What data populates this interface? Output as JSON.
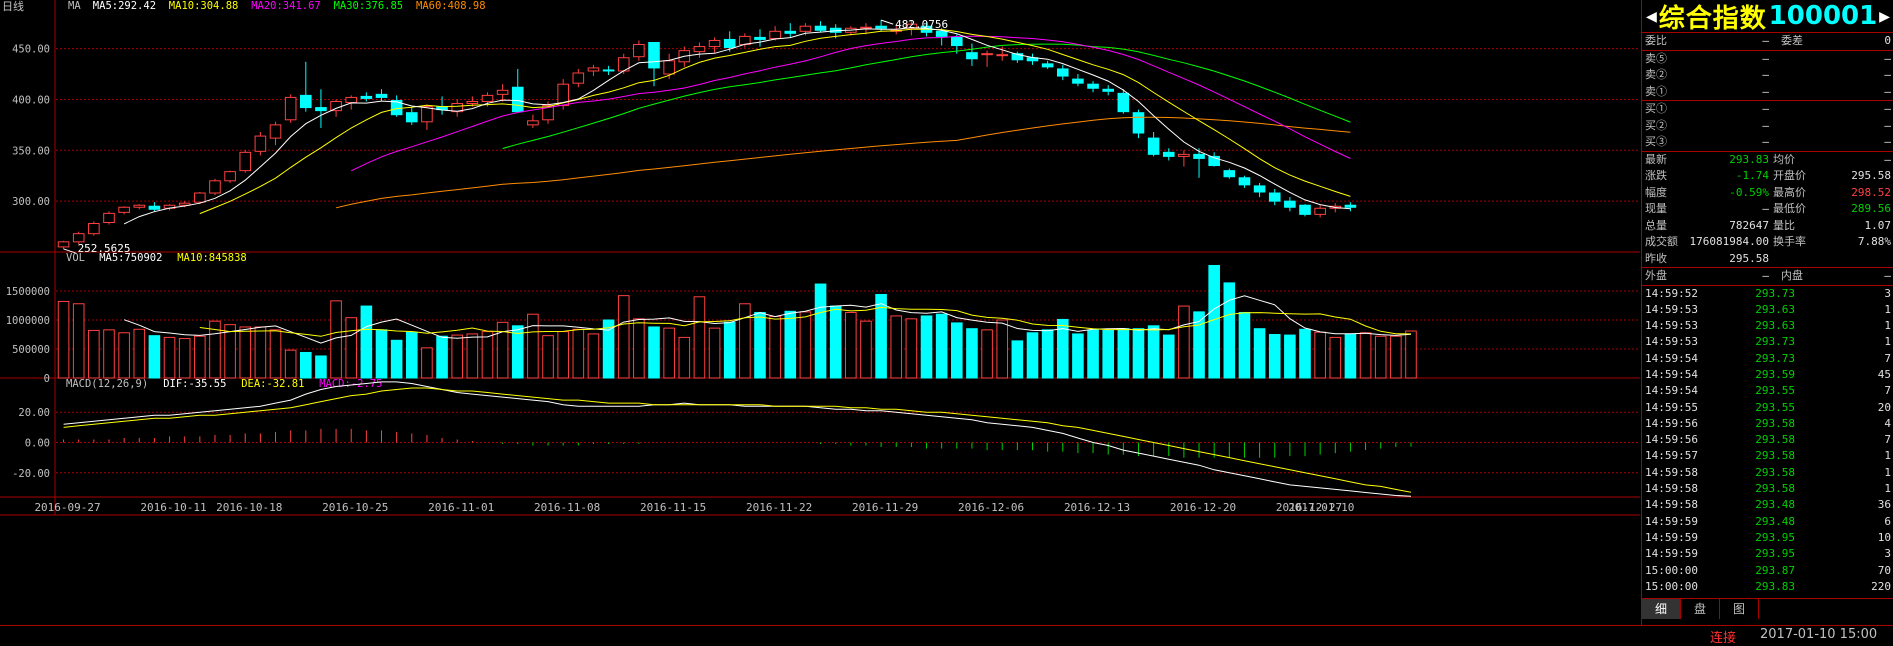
{
  "period_label": "日线",
  "ma_headers": [
    {
      "text": "MA",
      "color": "#c0c0c0"
    },
    {
      "text": "MA5:292.42",
      "color": "#ffffff"
    },
    {
      "text": "MA10:304.88",
      "color": "#ffff00"
    },
    {
      "text": "MA20:341.67",
      "color": "#ff00ff"
    },
    {
      "text": "MA30:376.85",
      "color": "#00ff00"
    },
    {
      "text": "MA60:408.98",
      "color": "#ff8c00"
    }
  ],
  "vol_headers": [
    {
      "text": "VOL",
      "color": "#c0c0c0"
    },
    {
      "text": "MA5:750902",
      "color": "#ffffff"
    },
    {
      "text": "MA10:845838",
      "color": "#ffff00"
    }
  ],
  "macd_headers": [
    {
      "text": "MACD(12,26,9)",
      "color": "#c0c0c0"
    },
    {
      "text": "DIF:-35.55",
      "color": "#ffffff"
    },
    {
      "text": "DEA:-32.81",
      "color": "#ffff00"
    },
    {
      "text": "MACD:-2.75",
      "color": "#ff00ff"
    }
  ],
  "chart_data": [
    {
      "type": "candlestick",
      "ylim": [
        250,
        485
      ],
      "y_ticks": [
        "450.00",
        "400.00",
        "350.00",
        "300.00"
      ],
      "max_label": "482.0756",
      "min_label": "252.5625",
      "colors": {
        "up": "#ff4040",
        "down": "#00ffff",
        "ma5": "#ffffff",
        "ma10": "#ffff00",
        "ma20": "#ff00ff",
        "ma30": "#00ff00",
        "ma60": "#ff8c00"
      },
      "candles": [
        [
          255,
          261,
          253,
          260
        ],
        [
          260,
          270,
          258,
          268
        ],
        [
          268,
          280,
          266,
          278
        ],
        [
          279,
          290,
          277,
          288
        ],
        [
          289,
          295,
          287,
          294
        ],
        [
          294,
          297,
          292,
          296
        ],
        [
          295,
          299,
          290,
          292
        ],
        [
          293,
          297,
          291,
          296
        ],
        [
          296,
          300,
          294,
          298
        ],
        [
          299,
          309,
          297,
          308
        ],
        [
          308,
          322,
          306,
          320
        ],
        [
          320,
          330,
          318,
          329
        ],
        [
          330,
          350,
          328,
          348
        ],
        [
          349,
          368,
          345,
          364
        ],
        [
          362,
          378,
          355,
          375
        ],
        [
          380,
          405,
          377,
          402
        ],
        [
          404,
          437,
          388,
          392
        ],
        [
          392,
          410,
          372,
          389
        ],
        [
          389,
          400,
          383,
          398
        ],
        [
          397,
          404,
          390,
          402
        ],
        [
          403,
          407,
          398,
          401
        ],
        [
          405,
          410,
          398,
          402
        ],
        [
          399,
          404,
          383,
          385
        ],
        [
          387,
          392,
          375,
          378
        ],
        [
          378,
          395,
          370,
          393
        ],
        [
          393,
          403,
          385,
          390
        ],
        [
          388,
          400,
          383,
          396
        ],
        [
          396,
          403,
          393,
          398
        ],
        [
          398,
          407,
          393,
          404
        ],
        [
          405,
          415,
          398,
          409
        ],
        [
          412,
          430,
          390,
          388
        ],
        [
          375,
          385,
          372,
          379
        ],
        [
          380,
          398,
          376,
          394
        ],
        [
          394,
          420,
          390,
          415
        ],
        [
          416,
          430,
          412,
          426
        ],
        [
          428,
          434,
          423,
          431
        ],
        [
          429,
          433,
          424,
          428
        ],
        [
          428,
          445,
          425,
          441
        ],
        [
          442,
          458,
          438,
          454
        ],
        [
          456,
          448,
          413,
          431
        ],
        [
          425,
          445,
          420,
          438
        ],
        [
          437,
          452,
          432,
          448
        ],
        [
          447,
          456,
          441,
          452
        ],
        [
          452,
          461,
          446,
          458
        ],
        [
          459,
          467,
          447,
          451
        ],
        [
          454,
          465,
          451,
          462
        ],
        [
          461,
          469,
          452,
          459
        ],
        [
          460,
          472,
          458,
          467
        ],
        [
          467,
          475,
          461,
          465
        ],
        [
          467,
          475,
          463,
          472
        ],
        [
          472,
          477,
          466,
          468
        ],
        [
          470,
          474,
          460,
          466
        ],
        [
          466,
          472,
          463,
          470
        ],
        [
          470,
          475,
          464,
          471
        ],
        [
          472,
          478,
          467,
          470
        ],
        [
          468,
          473,
          464,
          468
        ],
        [
          470,
          477,
          463,
          474
        ],
        [
          472,
          476,
          462,
          466
        ],
        [
          467,
          470,
          453,
          462
        ],
        [
          461,
          464,
          445,
          453
        ],
        [
          446,
          455,
          433,
          440
        ],
        [
          444,
          448,
          432,
          445
        ],
        [
          444,
          452,
          438,
          444
        ],
        [
          445,
          447,
          436,
          439
        ],
        [
          441,
          445,
          434,
          438
        ],
        [
          435,
          438,
          430,
          432
        ],
        [
          430,
          434,
          419,
          423
        ],
        [
          420,
          425,
          413,
          416
        ],
        [
          415,
          418,
          407,
          411
        ],
        [
          410,
          414,
          404,
          408
        ],
        [
          406,
          410,
          386,
          388
        ],
        [
          387,
          390,
          362,
          367
        ],
        [
          362,
          368,
          344,
          346
        ],
        [
          348,
          352,
          340,
          344
        ],
        [
          344,
          350,
          334,
          346
        ],
        [
          346,
          352,
          323,
          342
        ],
        [
          344,
          348,
          334,
          335
        ],
        [
          330,
          332,
          322,
          324
        ],
        [
          323,
          325,
          313,
          316
        ],
        [
          315,
          318,
          304,
          309
        ],
        [
          308,
          312,
          296,
          300
        ],
        [
          300,
          304,
          290,
          294
        ],
        [
          296,
          297,
          285,
          287
        ],
        [
          287,
          296,
          284,
          293
        ],
        [
          293,
          298,
          289,
          295
        ],
        [
          296,
          299,
          290,
          294
        ]
      ]
    },
    {
      "type": "bar",
      "y_ticks": [
        "1500000",
        "1000000",
        "500000",
        "0"
      ],
      "ylim": [
        0,
        2000000
      ],
      "values": [
        1320000,
        1280000,
        820000,
        830000,
        780000,
        840000,
        730000,
        700000,
        680000,
        720000,
        980000,
        920000,
        880000,
        880000,
        830000,
        480000,
        440000,
        380000,
        1330000,
        1040000,
        1240000,
        830000,
        650000,
        790000,
        520000,
        720000,
        740000,
        760000,
        800000,
        960000,
        900000,
        1100000,
        730000,
        800000,
        840000,
        760000,
        1000000,
        1420000,
        1020000,
        880000,
        860000,
        700000,
        1400000,
        860000,
        960000,
        1280000,
        1130000,
        1060000,
        1150000,
        1140000,
        1620000,
        1240000,
        1130000,
        980000,
        1440000,
        1070000,
        1020000,
        1070000,
        1100000,
        950000,
        850000,
        830000,
        1000000,
        640000,
        780000,
        830000,
        1010000,
        760000,
        830000,
        820000,
        850000,
        850000,
        900000,
        740000,
        1240000,
        1140000,
        1940000,
        1640000,
        1130000,
        850000,
        750000,
        740000,
        840000,
        790000,
        700000,
        750000,
        780000,
        720000,
        720000,
        810000
      ],
      "ma_lines": true
    },
    {
      "type": "line",
      "y_ticks": [
        "20.00",
        "0.00",
        "-20.00"
      ],
      "ylim": [
        -36,
        36
      ],
      "series": [
        {
          "name": "DIF",
          "color": "#ffffff",
          "values": [
            12,
            13,
            14,
            15,
            16,
            17,
            18,
            18,
            19,
            20,
            21,
            22,
            23,
            24,
            26,
            28,
            32,
            35,
            37,
            38,
            39,
            40,
            40,
            39,
            37,
            35,
            33,
            32,
            31,
            30,
            29,
            28,
            27,
            25,
            24,
            24,
            24,
            24,
            24,
            25,
            25,
            26,
            25,
            25,
            25,
            24,
            24,
            24,
            24,
            24,
            23,
            22,
            22,
            21,
            21,
            20,
            19,
            18,
            17,
            16,
            15,
            13,
            12,
            11,
            10,
            8,
            6,
            3,
            0,
            -2,
            -5,
            -7,
            -9,
            -11,
            -13,
            -15,
            -18,
            -20,
            -22,
            -24,
            -26,
            -28,
            -29,
            -30,
            -31,
            -32,
            -33,
            -34,
            -35,
            -35.55
          ]
        },
        {
          "name": "DEA",
          "color": "#ffff00",
          "values": [
            10,
            11,
            12,
            13,
            14,
            15,
            16,
            16,
            17,
            18,
            18,
            19,
            20,
            21,
            22,
            23,
            25,
            27,
            29,
            31,
            32,
            34,
            35,
            36,
            36,
            35,
            34,
            34,
            33,
            32,
            31,
            30,
            29,
            28,
            28,
            27,
            26,
            26,
            26,
            25,
            25,
            25,
            25,
            25,
            25,
            25,
            25,
            24,
            24,
            24,
            24,
            24,
            23,
            23,
            22,
            22,
            21,
            20,
            20,
            19,
            18,
            17,
            16,
            15,
            14,
            13,
            11,
            10,
            8,
            6,
            4,
            2,
            0,
            -2,
            -4,
            -6,
            -8,
            -10,
            -12,
            -14,
            -16,
            -18,
            -20,
            -22,
            -24,
            -26,
            -28,
            -29,
            -31,
            -32.81
          ]
        },
        {
          "name": "MACD",
          "color": "#ff00ff",
          "values": [
            2,
            2,
            2,
            2,
            3,
            3,
            3,
            4,
            4,
            4,
            5,
            5,
            6,
            6,
            7,
            8,
            8,
            9,
            9,
            9,
            8,
            8,
            7,
            6,
            5,
            3,
            2,
            1,
            0,
            -1,
            -1,
            -2,
            -2,
            -2,
            -2,
            -1,
            -1,
            -1,
            -1,
            0,
            0,
            0,
            0,
            0,
            0,
            0,
            0,
            0,
            0,
            0,
            -1,
            -1,
            -2,
            -2,
            -3,
            -3,
            -3,
            -4,
            -4,
            -4,
            -4,
            -5,
            -5,
            -5,
            -5,
            -6,
            -6,
            -7,
            -7,
            -8,
            -8,
            -9,
            -9,
            -9,
            -10,
            -10,
            -10,
            -10,
            -10,
            -10,
            -10,
            -9,
            -9,
            -8,
            -7,
            -6,
            -5,
            -4,
            -3,
            -2.75
          ]
        }
      ]
    }
  ],
  "date_ticks": [
    "2016-09-27",
    "2016-10-11",
    "2016-10-18",
    "2016-10-25",
    "2016-11-01",
    "2016-11-08",
    "2016-11-15",
    "2016-11-22",
    "2016-11-29",
    "2016-12-06",
    "2016-12-13",
    "2016-12-20",
    "2016-12-27",
    "2017-01-10"
  ],
  "panel": {
    "name": "综合指数",
    "code": "100001",
    "weibi_label": "委比",
    "weibi_value": "—",
    "weicha_label": "委差",
    "weicha_value": "0",
    "sells": [
      {
        "label": "卖⑤",
        "price": "—",
        "vol": "—"
      },
      {
        "label": "卖②",
        "price": "—",
        "vol": "—"
      },
      {
        "label": "卖①",
        "price": "—",
        "vol": "—"
      }
    ],
    "buys": [
      {
        "label": "买①",
        "price": "—",
        "vol": "—"
      },
      {
        "label": "买②",
        "price": "—",
        "vol": "—"
      },
      {
        "label": "买③",
        "price": "—",
        "vol": "—"
      }
    ],
    "stats": [
      {
        "l1": "最新",
        "v1": "293.83",
        "c1": "c-g",
        "l2": "均价",
        "v2": "—",
        "c2": "c-w"
      },
      {
        "l1": "涨跌",
        "v1": "-1.74",
        "c1": "c-g",
        "l2": "开盘价",
        "v2": "295.58",
        "c2": "c-w"
      },
      {
        "l1": "幅度",
        "v1": "-0.59%",
        "c1": "c-g",
        "l2": "最高价",
        "v2": "298.52",
        "c2": "c-r"
      },
      {
        "l1": "现量",
        "v1": "—",
        "c1": "c-w",
        "l2": "最低价",
        "v2": "289.56",
        "c2": "c-g"
      },
      {
        "l1": "总量",
        "v1": "782647",
        "c1": "c-w",
        "l2": "量比",
        "v2": "1.07",
        "c2": "c-w"
      },
      {
        "l1": "成交额",
        "v1": "176081984.00",
        "c1": "c-w",
        "l2": "换手率",
        "v2": "7.88%",
        "c2": "c-w"
      },
      {
        "l1": "昨收",
        "v1": "295.58",
        "c1": "c-w",
        "l2": "",
        "v2": "",
        "c2": "c-w"
      }
    ],
    "outer_label": "外盘",
    "outer_value": "—",
    "inner_label": "内盘",
    "inner_value": "—",
    "ticks": [
      {
        "t": "14:59:52",
        "p": "293.73",
        "v": "3"
      },
      {
        "t": "14:59:53",
        "p": "293.63",
        "v": "1"
      },
      {
        "t": "14:59:53",
        "p": "293.63",
        "v": "1"
      },
      {
        "t": "14:59:53",
        "p": "293.73",
        "v": "1"
      },
      {
        "t": "14:59:54",
        "p": "293.73",
        "v": "7"
      },
      {
        "t": "14:59:54",
        "p": "293.59",
        "v": "45"
      },
      {
        "t": "14:59:54",
        "p": "293.55",
        "v": "7"
      },
      {
        "t": "14:59:55",
        "p": "293.55",
        "v": "20"
      },
      {
        "t": "14:59:56",
        "p": "293.58",
        "v": "4"
      },
      {
        "t": "14:59:56",
        "p": "293.58",
        "v": "7"
      },
      {
        "t": "14:59:57",
        "p": "293.58",
        "v": "1"
      },
      {
        "t": "14:59:58",
        "p": "293.58",
        "v": "1"
      },
      {
        "t": "14:59:58",
        "p": "293.58",
        "v": "1"
      },
      {
        "t": "14:59:58",
        "p": "293.48",
        "v": "36"
      },
      {
        "t": "14:59:59",
        "p": "293.48",
        "v": "6"
      },
      {
        "t": "14:59:59",
        "p": "293.95",
        "v": "10"
      },
      {
        "t": "14:59:59",
        "p": "293.95",
        "v": "3"
      },
      {
        "t": "15:00:00",
        "p": "293.87",
        "v": "70"
      },
      {
        "t": "15:00:00",
        "p": "293.83",
        "v": "220"
      }
    ],
    "tabs": [
      "细",
      "盘",
      "图"
    ]
  },
  "status": {
    "connection": "连接",
    "datetime": "2017-01-10 15:00"
  }
}
